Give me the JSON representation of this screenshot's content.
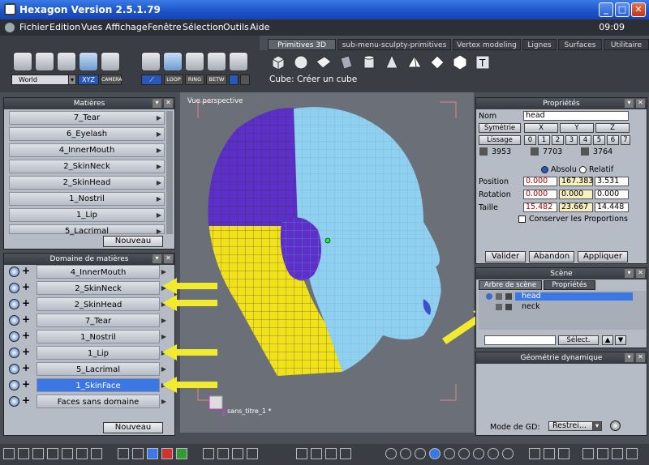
{
  "window": {
    "title": "Hexagon Version 2.5.1.79",
    "minimize": "_",
    "maximize": "□",
    "close": "✕"
  },
  "menu": {
    "items": [
      "Fichier",
      "Edition",
      "Vues",
      "Affichage",
      "Fenêtre",
      "Sélection",
      "Outils",
      "Aide"
    ],
    "clock": "09:09"
  },
  "tabs": [
    "Primitives 3D",
    "sub-menu-sculpty-primitives",
    "Vertex modeling",
    "Lignes",
    "Surfaces",
    "Utilitaire"
  ],
  "toolbar": {
    "world_select": "World",
    "xyz": "XYZ",
    "camera": "CAMERA",
    "loop": "LOOP",
    "ring": "RING",
    "betw": "BETW"
  },
  "status": "Cube: Créer un cube",
  "materials": {
    "title": "Matières",
    "items": [
      "7_Tear",
      "6_Eyelash",
      "4_InnerMouth",
      "2_SkinNeck",
      "2_SkinHead",
      "1_Nostril",
      "1_Lip",
      "5_Lacrimal"
    ],
    "new_button": "Nouveau"
  },
  "domains": {
    "title": "Domaine de matières",
    "items": [
      "4_InnerMouth",
      "2_SkinNeck",
      "2_SkinHead",
      "7_Tear",
      "1_Nostril",
      "1_Lip",
      "5_Lacrimal",
      "1_SkinFace",
      "Faces sans domaine"
    ],
    "selected": "1_SkinFace",
    "new_button": "Nouveau"
  },
  "viewport": {
    "label": "Vue perspective",
    "scene_label": "sans_titre_1 *"
  },
  "properties": {
    "title": "Propriétés",
    "name_label": "Nom",
    "name_value": "head",
    "symmetry_label": "Symétrie",
    "sym_axes": [
      "X",
      "Y",
      "Z"
    ],
    "smooth_label": "Lissage",
    "smooth_levels": [
      "0",
      "1",
      "2",
      "3",
      "4",
      "5",
      "6",
      "7"
    ],
    "counts": [
      "3953",
      "7703",
      "3764"
    ],
    "absolute": "Absolu",
    "relative": "Relatif",
    "position_label": "Position",
    "position": [
      "0.000",
      "167.383",
      "3.531"
    ],
    "rotation_label": "Rotation",
    "rotation": [
      "0.000",
      "0.000",
      "0.000"
    ],
    "size_label": "Taille",
    "size": [
      "15.482",
      "23.667",
      "14.448"
    ],
    "keep_proportions": "Conserver les Proportions",
    "validate": "Valider",
    "cancel": "Abandon",
    "apply": "Appliquer"
  },
  "scene": {
    "title": "Scène",
    "tabs": [
      "Arbre de scène",
      "Propriétés"
    ],
    "items": [
      "head",
      "neck"
    ],
    "select_button": "Sélect."
  },
  "dynamic": {
    "title": "Géométrie dynamique",
    "mode_label": "Mode de GD:",
    "mode_value": "Restrei..."
  },
  "colors": {
    "accent": "#3b78e6",
    "skin_blue": "#8fd0f0",
    "purple": "#5b2fc8",
    "yellow": "#f2e21c",
    "arrow": "#f2ea2e"
  }
}
